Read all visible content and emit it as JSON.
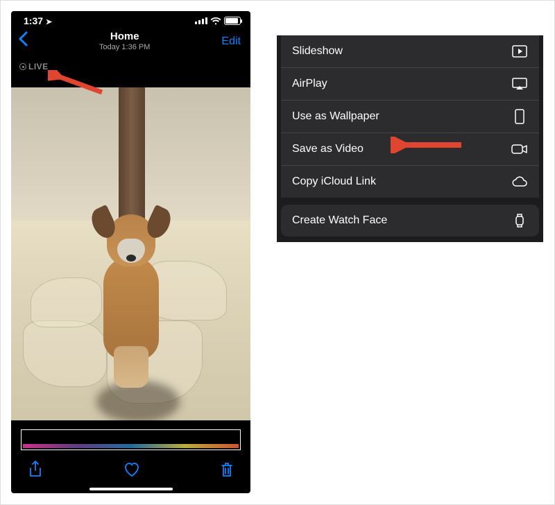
{
  "status": {
    "time": "1:37",
    "location_arrow": "➤"
  },
  "nav": {
    "title": "Home",
    "subtitle": "Today 1:36 PM",
    "edit": "Edit"
  },
  "live_badge": "LIVE",
  "colors": {
    "ios_blue": "#0a84ff",
    "arrow_red": "#e0452f"
  },
  "sheet": {
    "items": [
      {
        "label": "Slideshow",
        "icon": "play-box-icon"
      },
      {
        "label": "AirPlay",
        "icon": "airplay-icon"
      },
      {
        "label": "Use as Wallpaper",
        "icon": "phone-rect-icon"
      },
      {
        "label": "Save as Video",
        "icon": "video-camera-icon"
      },
      {
        "label": "Copy iCloud Link",
        "icon": "cloud-icon"
      }
    ],
    "secondary": [
      {
        "label": "Create Watch Face",
        "icon": "watch-icon"
      }
    ]
  }
}
